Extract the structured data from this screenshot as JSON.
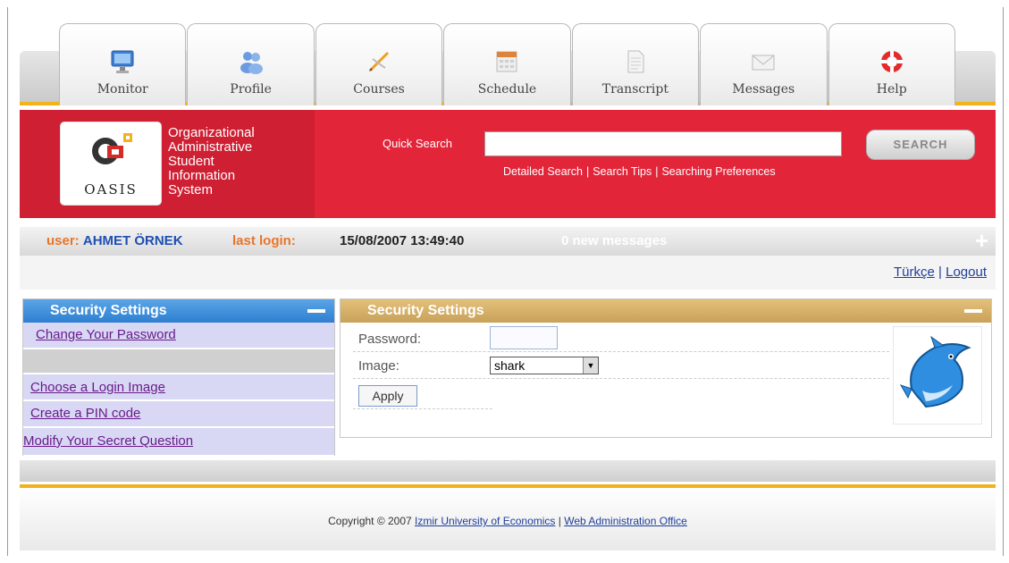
{
  "tabs": [
    {
      "label": "Monitor",
      "icon": "monitor-icon"
    },
    {
      "label": "Profile",
      "icon": "profile-icon"
    },
    {
      "label": "Courses",
      "icon": "courses-icon"
    },
    {
      "label": "Schedule",
      "icon": "calendar-icon"
    },
    {
      "label": "Transcript",
      "icon": "document-icon"
    },
    {
      "label": "Messages",
      "icon": "envelope-icon"
    },
    {
      "label": "Help",
      "icon": "lifebuoy-icon"
    }
  ],
  "brand": {
    "logo_text": "OASIS",
    "line1": "Organizational",
    "line2": "Administrative",
    "line3": "Student",
    "line4": "Information",
    "line5": "System"
  },
  "search": {
    "label": "Quick Search",
    "value": "",
    "button": "SEARCH",
    "links": [
      "Detailed Search",
      "Search Tips",
      "Searching Preferences"
    ]
  },
  "userbar": {
    "user_label": "user:",
    "user_name": "AHMET ÖRNEK",
    "last_login_label": "last login:",
    "last_login": "15/08/2007 13:49:40",
    "messages": "0 new messages",
    "expand": "+"
  },
  "lang": {
    "language": "Türkçe",
    "logout": "Logout"
  },
  "menu": {
    "title": "Security Settings",
    "items": [
      "Change Your Password",
      "Choose a Login Image",
      "Create a PIN code",
      "Modify Your Secret Question"
    ]
  },
  "security": {
    "title": "Security Settings",
    "password_label": "Password:",
    "password_value": "",
    "image_label": "Image:",
    "image_selected": "shark",
    "apply": "Apply",
    "preview_icon": "shark-icon"
  },
  "footer": {
    "copyright": "Copyright © 2007",
    "university": "Izmir University of Economics",
    "office": "Web Administration Office"
  },
  "colors": {
    "accent": "#f2b21c",
    "header_red": "#e3253a",
    "menu_blue": "#2d7fd2",
    "panel_gold": "#c9a15a"
  }
}
